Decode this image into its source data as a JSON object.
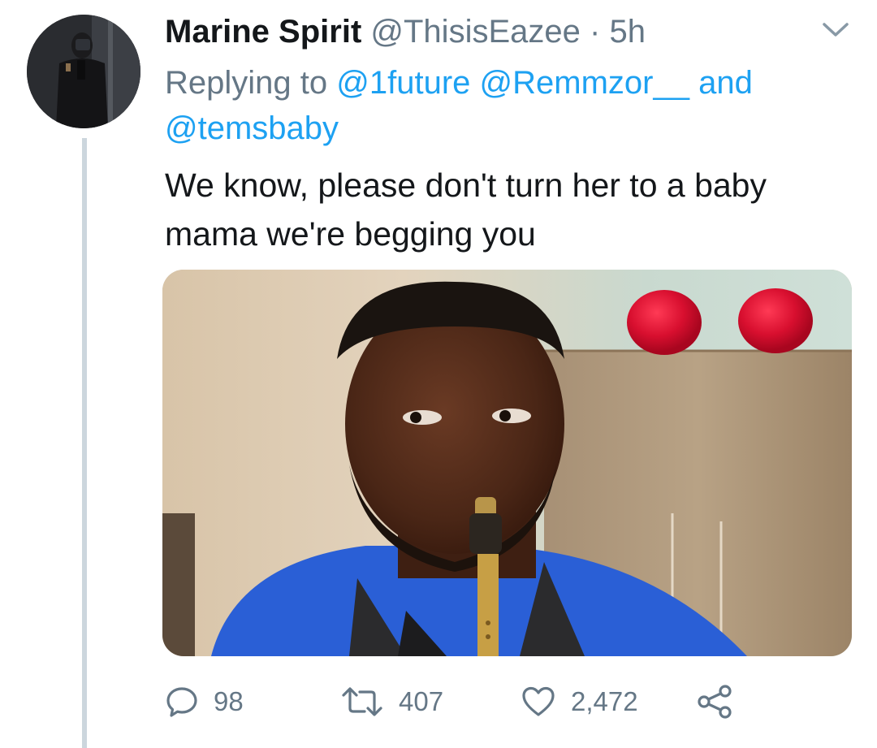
{
  "tweet": {
    "author_name": "Marine Spirit",
    "author_handle": "@ThisisEazee",
    "separator": "·",
    "time": "5h",
    "replying_prefix": "Replying to",
    "mentions": [
      "@1future",
      "@Remmzor__",
      "@temsbaby"
    ],
    "mention_joiner": "and",
    "text_line1": "We know, please don't turn her to a baby",
    "text_line2": "mama we're begging you"
  },
  "actions": {
    "replies": "98",
    "retweets": "407",
    "likes": "2,472"
  },
  "icons": {
    "reply": "reply-bubble-icon",
    "retweet": "retweet-icon",
    "like": "heart-icon",
    "share": "share-icon",
    "menu": "chevron-down-icon"
  },
  "colors": {
    "link": "#1da1f2",
    "secondary_text": "#657786",
    "primary_text": "#14171a",
    "thread_line": "#ccd6dd"
  }
}
